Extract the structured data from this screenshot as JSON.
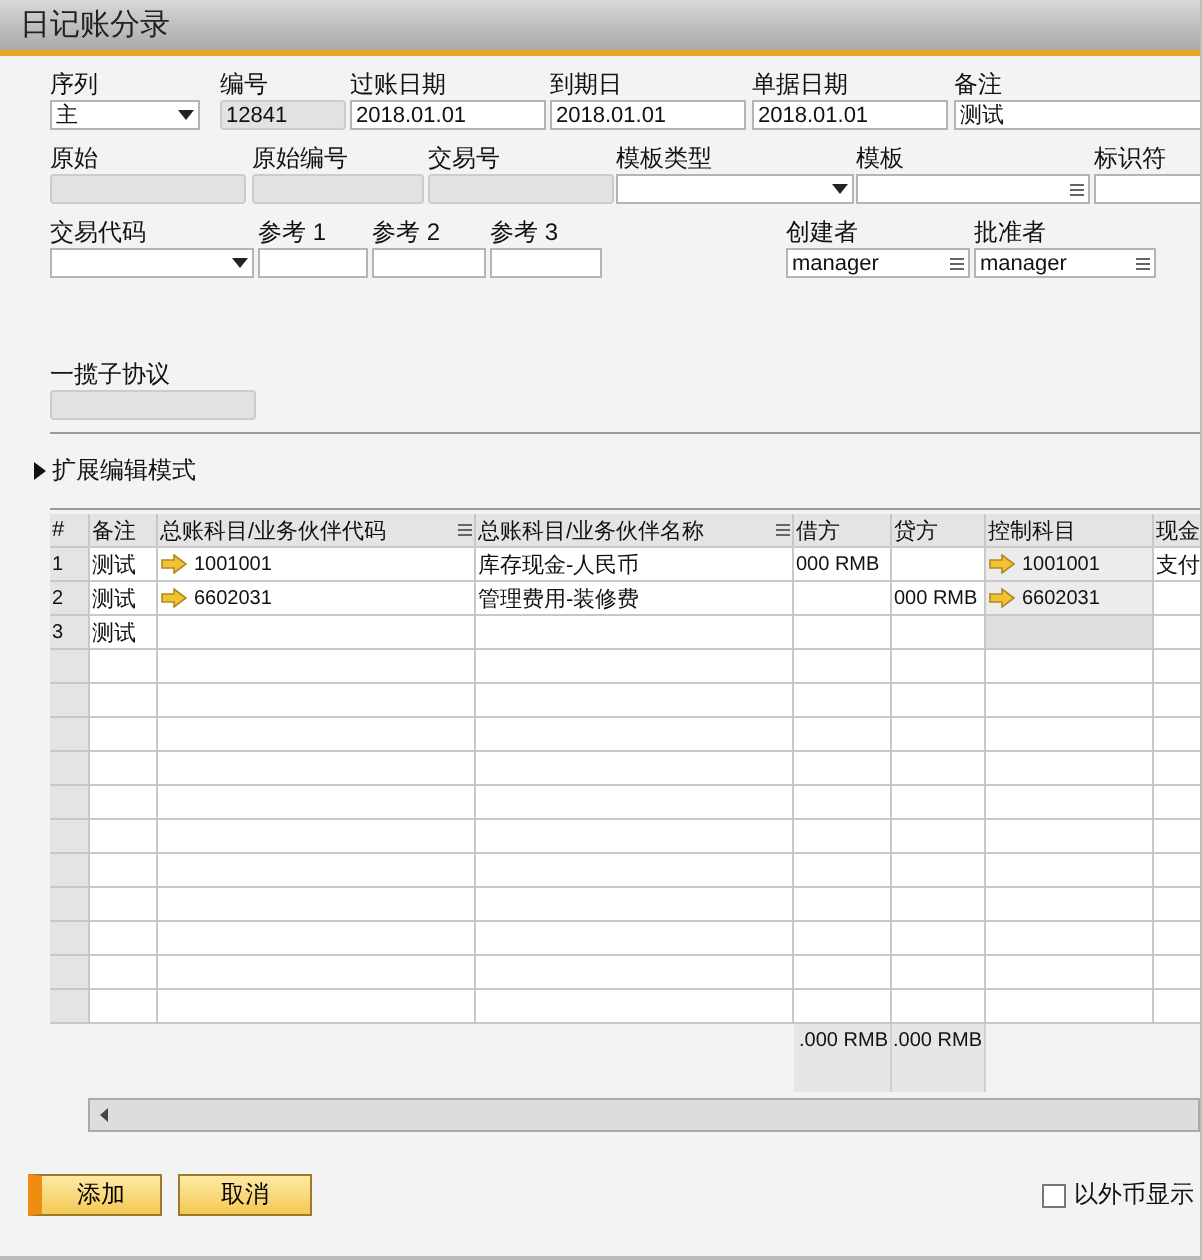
{
  "window": {
    "title": "日记账分录"
  },
  "form_rows": [
    [
      {
        "label": "序列",
        "kind": "dropdown",
        "value": "主"
      },
      {
        "label": "编号",
        "kind": "readonly",
        "value": "12841"
      },
      {
        "label": "过账日期",
        "kind": "text",
        "value": "2018.01.01"
      },
      {
        "label": "到期日",
        "kind": "text",
        "value": "2018.01.01"
      },
      {
        "label": "单据日期",
        "kind": "text",
        "value": "2018.01.01"
      },
      {
        "label": "备注",
        "kind": "text",
        "value": "测试"
      }
    ],
    [
      {
        "label": "原始",
        "kind": "readonly"
      },
      {
        "label": "原始编号",
        "kind": "readonly"
      },
      {
        "label": "交易号",
        "kind": "readonly"
      },
      {
        "label": "模板类型",
        "kind": "dropdown"
      },
      {
        "label": "模板",
        "kind": "choose"
      },
      {
        "label": "标识符",
        "kind": "text"
      }
    ],
    [
      {
        "label": "交易代码",
        "kind": "dropdown"
      },
      {
        "label": "参考 1",
        "kind": "text"
      },
      {
        "label": "参考 2",
        "kind": "text"
      },
      {
        "label": "参考 3",
        "kind": "text"
      },
      {
        "label": "创建者",
        "kind": "choose",
        "value": "manager"
      },
      {
        "label": "批准者",
        "kind": "choose",
        "value": "manager"
      }
    ],
    [
      {
        "label": "一揽子协议",
        "kind": "readonly"
      }
    ]
  ],
  "expander": {
    "label": "扩展编辑模式",
    "expanded": false
  },
  "table": {
    "columns": [
      {
        "label": "#",
        "menu": false
      },
      {
        "label": "备注",
        "menu": false
      },
      {
        "label": "总账科目/业务伙伴代码",
        "menu": true
      },
      {
        "label": "总账科目/业务伙伴名称",
        "menu": true
      },
      {
        "label": "借方",
        "menu": false
      },
      {
        "label": "贷方",
        "menu": false
      },
      {
        "label": "控制科目",
        "menu": false
      },
      {
        "label": "现金",
        "menu": false
      }
    ],
    "rows": [
      {
        "num": "1",
        "remark": "测试",
        "account_code": "1001001",
        "account_name": "库存现金-人民币",
        "debit": "000 RMB",
        "credit": "",
        "control_account": "1001001",
        "cash": "支付"
      },
      {
        "num": "2",
        "remark": "测试",
        "account_code": "6602031",
        "account_name": "管理费用-装修费",
        "debit": "",
        "credit": "000 RMB",
        "control_account": "6602031",
        "cash": ""
      },
      {
        "num": "3",
        "remark": "测试",
        "account_code": "",
        "account_name": "",
        "debit": "",
        "credit": "",
        "control_account": "",
        "cash": ""
      }
    ],
    "totals": {
      "debit": ".000 RMB",
      "credit": ".000 RMB"
    }
  },
  "buttons": [
    {
      "label": "添加",
      "focused": true
    },
    {
      "label": "取消",
      "focused": false
    }
  ],
  "foreign_currency": {
    "label": "以外币显示",
    "checked": false
  }
}
